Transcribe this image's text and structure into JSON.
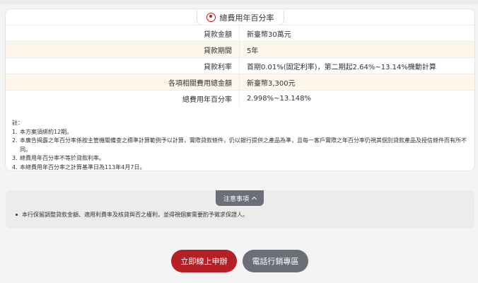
{
  "card": {
    "title": "總費用年百分率"
  },
  "table": {
    "rows": [
      {
        "label": "貸款金額",
        "value": "新臺幣30萬元"
      },
      {
        "label": "貸款期間",
        "value": "5年"
      },
      {
        "label": "貸款利率",
        "value": "首期0.01%(固定利率)，第二期起2.64%~13.14%機動計算"
      },
      {
        "label": "各項相關費用總金額",
        "value": "新臺幣3,300元"
      },
      {
        "label": "總費用年百分率",
        "value": "2.998%~13.148%"
      }
    ]
  },
  "notes": {
    "heading": "註：",
    "items": [
      {
        "num": "1.",
        "text": "本方案須綁約12期。"
      },
      {
        "num": "2.",
        "text": "本廣告揭露之年百分率係按主管機關備查之標準計算範例予以計算，實際貸款條件，仍以銀行提供之產品為準，且每一客戶實際之年百分率仍視其個別貸款產品及授信條件而有所不同。"
      },
      {
        "num": "3.",
        "text": "總費用年百分率不等於貸款利率。"
      },
      {
        "num": "4.",
        "text": "本總費用年百分率之計算基準日為113年4月7日。"
      }
    ]
  },
  "notice": {
    "tab_label": "注意事項",
    "item": "本行保留調整貸款金額、適用利費率及核貸與否之權利，並得視個案需要酌予徵求保證人。"
  },
  "buttons": {
    "apply": "立即線上申辦",
    "phone": "電話行銷專區"
  },
  "colors": {
    "accent_red": "#b52027",
    "grey_button": "#6b7078",
    "row_highlight": "#fdf6ea"
  }
}
